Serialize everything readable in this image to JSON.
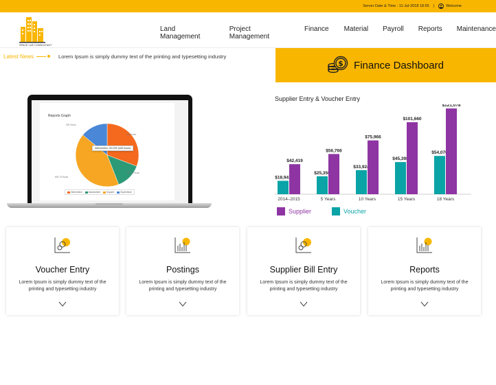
{
  "topbar": {
    "server_label": "Server Date & Time : 11-Jul-2018 18:55",
    "welcome": "Welcome",
    "user_icon": "user-icon"
  },
  "logo": {
    "text": "SPACE LUE CONSULTANT"
  },
  "nav": {
    "items": [
      "Land Management",
      "Project Management",
      "Finance",
      "Material",
      "Payroll",
      "Reports",
      "Maintenance"
    ]
  },
  "news": {
    "label": "Latest News",
    "text": "Lorem Ipsum is simply dummy text of the printing and typesetting industry"
  },
  "banner": {
    "title": "Finance Dashboard",
    "icon": "coins-dollar-icon"
  },
  "laptop": {
    "graph_title": "Reports Graph",
    "tooltip": "Intervention: 30.10% (440 hours)",
    "labels": {
      "top_left": "200 Hours",
      "top_right": "440 hours",
      "right": "190.50 Hours",
      "bottom_left": "600.70 Hours"
    },
    "legend": [
      "Intervention",
      "Assessment",
      "Support",
      "Supervision"
    ],
    "pie": {
      "slices": [
        {
          "name": "Intervention",
          "value": 440,
          "color": "#f4691e"
        },
        {
          "name": "Assessment",
          "value": 190.5,
          "color": "#2c9a76"
        },
        {
          "name": "Support",
          "value": 600.7,
          "color": "#f6a623"
        },
        {
          "name": "Supervision",
          "value": 200,
          "color": "#4a87d6"
        }
      ]
    }
  },
  "colors": {
    "accent": "#f9b600",
    "supplier": "#8e35a3",
    "voucher": "#0aa3a6"
  },
  "chart_data": {
    "type": "bar",
    "title": "Supplier Entry & Voucher Entry",
    "categories": [
      "2014–2015",
      "5 Years",
      "10 Years",
      "15 Years",
      "18 Years"
    ],
    "series": [
      {
        "name": "Voucher",
        "values": [
          18943,
          25350,
          33924,
          45398,
          54070
        ],
        "labels": [
          "$18,943",
          "$25,350",
          "$33,924",
          "$45,398",
          "$54,070"
        ]
      },
      {
        "name": "Supplier",
        "values": [
          42419,
          56766,
          75966,
          101660,
          121078
        ],
        "labels": [
          "$42,419",
          "$56,766",
          "$75,966",
          "$101,660",
          "$121,078"
        ]
      }
    ],
    "ylim": [
      0,
      125000
    ],
    "grid": false,
    "legend": "bottom-left"
  },
  "cards": [
    {
      "title": "Voucher Entry",
      "desc": "Lorem Ipsum is simply dummy text of the printing and typesetting industry",
      "icon": "voucher-icon"
    },
    {
      "title": "Postings",
      "desc": "Lorem Ipsum is simply dummy text of the printing and typesetting industry",
      "icon": "bar-chart-icon"
    },
    {
      "title": "Supplier Bill Entry",
      "desc": "Lorem Ipsum is simply dummy text of the printing and typesetting industry",
      "icon": "voucher-icon"
    },
    {
      "title": "Reports",
      "desc": "Lorem Ipsum is simply dummy text of the printing and typesetting industry",
      "icon": "bar-chart-icon"
    }
  ]
}
